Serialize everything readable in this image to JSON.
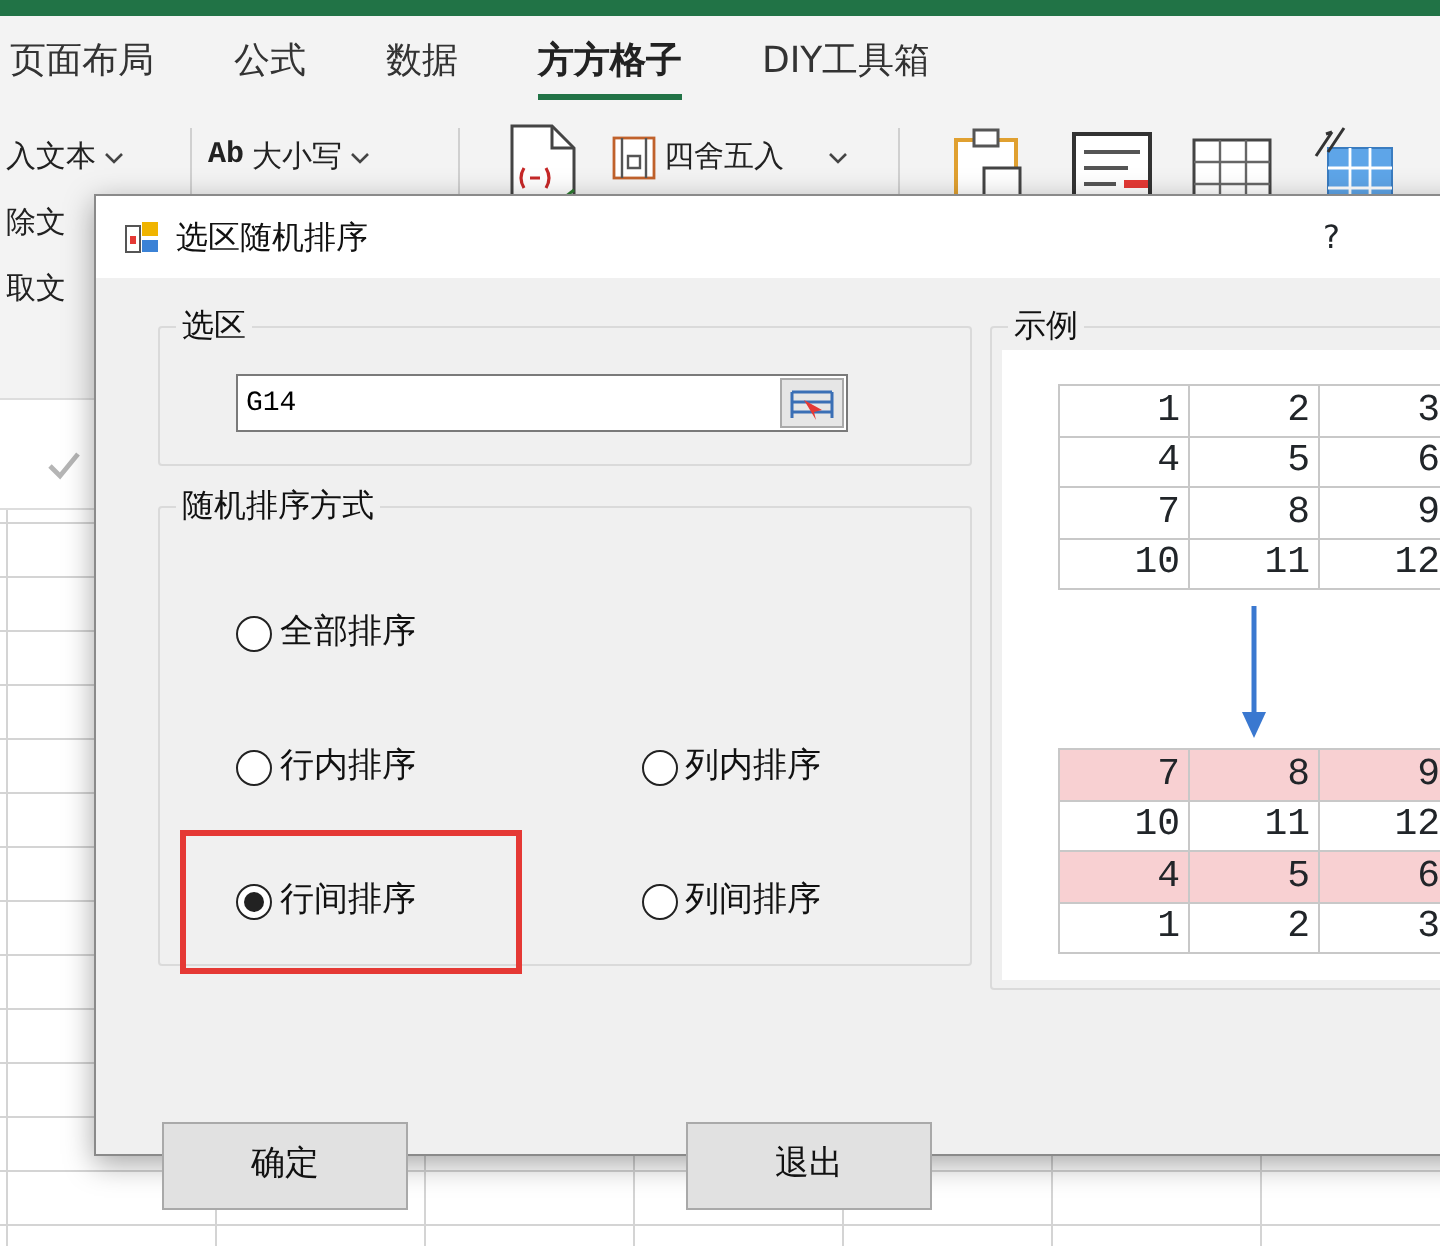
{
  "ribbon": {
    "tabs": [
      {
        "label": "页面布局",
        "selected": false
      },
      {
        "label": "公式",
        "selected": false
      },
      {
        "label": "数据",
        "selected": false
      },
      {
        "label": "方方格子",
        "selected": true
      },
      {
        "label": "DIY工具箱",
        "selected": false
      }
    ],
    "text_tools": [
      {
        "label": "入文本",
        "dropdown": true
      },
      {
        "label": "除文",
        "dropdown": false
      },
      {
        "label": "取文",
        "dropdown": false
      }
    ],
    "case_tool": {
      "icon_text": "Ab",
      "label": "大小写"
    },
    "round_tool": {
      "label": "四舍五入"
    }
  },
  "dialog": {
    "title": "选区随机排序",
    "help": "?",
    "selection_group": {
      "legend": "选区",
      "value": "G14"
    },
    "mode_group": {
      "legend": "随机排序方式",
      "rows": [
        [
          {
            "label": "全部排序",
            "selected": false,
            "highlighted": false
          }
        ],
        [
          {
            "label": "行内排序",
            "selected": false,
            "highlighted": false
          },
          {
            "label": "列内排序",
            "selected": false,
            "highlighted": false
          }
        ],
        [
          {
            "label": "行间排序",
            "selected": true,
            "highlighted": true
          },
          {
            "label": "列间排序",
            "selected": false,
            "highlighted": false
          }
        ]
      ]
    },
    "example_group": {
      "legend": "示例",
      "before": [
        {
          "cells": [
            "1",
            "2",
            "3"
          ],
          "highlighted": false
        },
        {
          "cells": [
            "4",
            "5",
            "6"
          ],
          "highlighted": false
        },
        {
          "cells": [
            "7",
            "8",
            "9"
          ],
          "highlighted": false
        },
        {
          "cells": [
            "10",
            "11",
            "12"
          ],
          "highlighted": false
        }
      ],
      "after": [
        {
          "cells": [
            "7",
            "8",
            "9"
          ],
          "highlighted": true
        },
        {
          "cells": [
            "10",
            "11",
            "12"
          ],
          "highlighted": false
        },
        {
          "cells": [
            "4",
            "5",
            "6"
          ],
          "highlighted": true
        },
        {
          "cells": [
            "1",
            "2",
            "3"
          ],
          "highlighted": false
        }
      ]
    },
    "buttons": [
      "确定",
      "退出"
    ]
  }
}
